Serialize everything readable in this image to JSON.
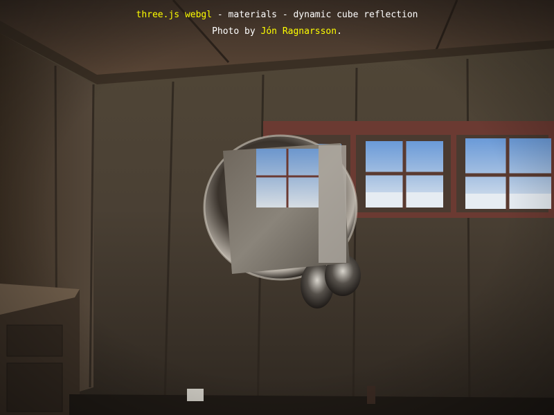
{
  "info": {
    "link_label": "three.js webgl",
    "title_rest": " - materials - dynamic cube reflection",
    "photo_prefix": "Photo by ",
    "photographer": "Jón Ragnarsson",
    "photo_suffix": "."
  },
  "colors": {
    "info_text": "#ffffff",
    "info_link": "#ffff00"
  }
}
